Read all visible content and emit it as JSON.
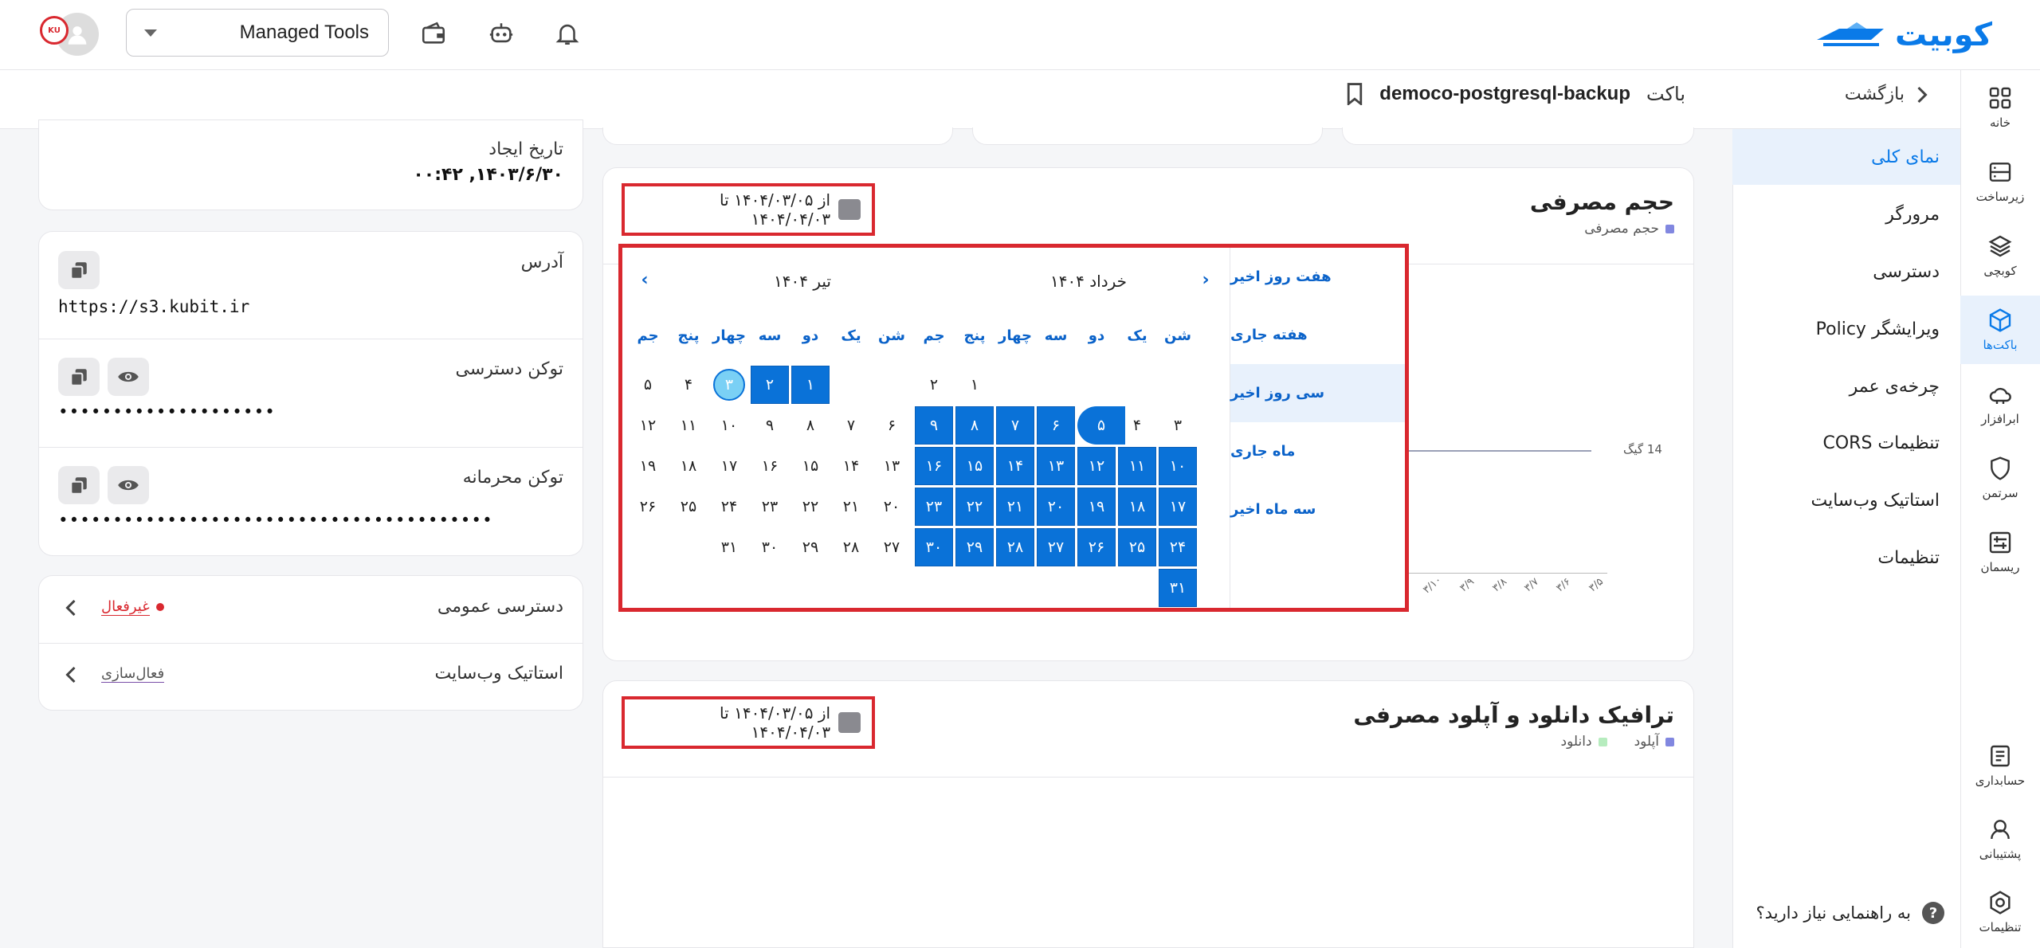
{
  "topbar": {
    "logo_text": "کوبیت",
    "workspace_label": "Managed Tools",
    "avatar_badge": "KU"
  },
  "subheader": {
    "back_label": "بازگشت",
    "title_prefix": "باکت",
    "bucket_name": "democo-postgresql-backup"
  },
  "rail": {
    "items": [
      {
        "label": "خانه",
        "icon": "grid-icon"
      },
      {
        "label": "زیرساخت",
        "icon": "server-icon"
      },
      {
        "label": "کوبچی",
        "icon": "layers-icon"
      },
      {
        "label": "باکت‌ها",
        "icon": "bucket-icon"
      },
      {
        "label": "ابرافزار",
        "icon": "cloud-icon"
      },
      {
        "label": "سرتمن",
        "icon": "shield-icon"
      },
      {
        "label": "ریسمان",
        "icon": "network-icon"
      }
    ],
    "bottom_items": [
      {
        "label": "حسابداری",
        "icon": "billing-icon"
      },
      {
        "label": "پشتیبانی",
        "icon": "support-icon"
      },
      {
        "label": "تنظیمات",
        "icon": "settings-icon"
      }
    ]
  },
  "menu": {
    "items": [
      {
        "label": "نمای کلی"
      },
      {
        "label": "مرورگر"
      },
      {
        "label": "دسترسی"
      },
      {
        "label": "ویرایشگر Policy"
      },
      {
        "label": "چرخه‌ی عمر"
      },
      {
        "label": "تنظیمات CORS"
      },
      {
        "label": "استاتیک وب‌سایت"
      },
      {
        "label": "تنظیمات"
      }
    ],
    "help": "به راهنمایی نیاز دارید؟"
  },
  "info": {
    "created_label": "تاریخ ایجاد",
    "created_value": "۱۴۰۳/۶/۳۰, ۰۰:۴۲",
    "address_label": "آدرس",
    "address_value": "https://s3.kubit.ir",
    "access_token_label": "توکن دسترسی",
    "access_token_value": "••••••••••••••••••••",
    "secret_token_label": "توکن محرمانه",
    "secret_token_value": "••••••••••••••••••••••••••••••••••••••••",
    "public_access_label": "دسترسی عمومی",
    "public_access_status": "غیرفعال",
    "static_site_label": "استاتیک وب‌سایت",
    "static_site_action": "فعال‌سازی"
  },
  "usage": {
    "title": "حجم مصرفی",
    "legend": "حجم مصرفی",
    "date_range": "از ۱۴۰۴/۰۳/۰۵ تا ۱۴۰۴/۰۴/۰۳",
    "y_label": "14 گیگ",
    "x_ticks": [
      "۳/۱۰",
      "۳/۹",
      "۳/۸",
      "۳/۷",
      "۳/۶",
      "۳/۵"
    ]
  },
  "traffic": {
    "title": "ترافیک دانلود و آپلود مصرفی",
    "legend_upload": "آپلود",
    "legend_download": "دانلود",
    "date_range": "از ۱۴۰۴/۰۳/۰۵ تا ۱۴۰۴/۰۴/۰۳"
  },
  "calendar": {
    "presets": [
      "هفت روز اخیر",
      "هفته جاری",
      "سی روز اخیر",
      "ماه جاری",
      "سه ماه اخیر"
    ],
    "weekdays": [
      "شن",
      "یک",
      "دو",
      "سه",
      "چهار",
      "پنج",
      "جم"
    ],
    "right_month": "خرداد ۱۴۰۴",
    "left_month": "تیر ۱۴۰۴",
    "right_days": [
      "۱",
      "۲",
      "۳",
      "۴",
      "۵",
      "۶",
      "۷",
      "۸",
      "۹",
      "۱۰",
      "۱۱",
      "۱۲",
      "۱۳",
      "۱۴",
      "۱۵",
      "۱۶",
      "۱۷",
      "۱۸",
      "۱۹",
      "۲۰",
      "۲۱",
      "۲۲",
      "۲۳",
      "۲۴",
      "۲۵",
      "۲۶",
      "۲۷",
      "۲۸",
      "۲۹",
      "۳۰",
      "۳۱"
    ],
    "left_days": [
      "۱",
      "۲",
      "۳",
      "۴",
      "۵",
      "۶",
      "۷",
      "۸",
      "۹",
      "۱۰",
      "۱۱",
      "۱۲",
      "۱۳",
      "۱۴",
      "۱۵",
      "۱۶",
      "۱۷",
      "۱۸",
      "۱۹",
      "۲۰",
      "۲۱",
      "۲۲",
      "۲۳",
      "۲۴",
      "۲۵",
      "۲۶",
      "۲۷",
      "۲۸",
      "۲۹",
      "۳۰",
      "۳۱"
    ]
  },
  "colors": {
    "accent": "#0a72d8",
    "highlight": "#d9282f",
    "today": "#7ad0f5"
  }
}
